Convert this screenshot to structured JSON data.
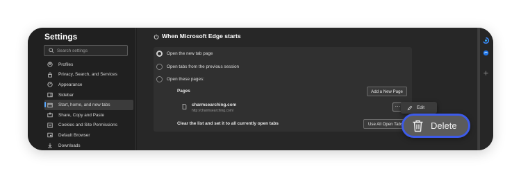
{
  "sidebar": {
    "title": "Settings",
    "search_placeholder": "Search settings",
    "items": [
      {
        "label": "Profiles",
        "icon": "profile-icon"
      },
      {
        "label": "Privacy, Search, and Services",
        "icon": "lock-icon"
      },
      {
        "label": "Appearance",
        "icon": "appearance-icon"
      },
      {
        "label": "Sidebar",
        "icon": "sidebar-icon"
      },
      {
        "label": "Start, home, and new tabs",
        "icon": "home-icon",
        "active": true
      },
      {
        "label": "Share, Copy and Paste",
        "icon": "share-icon"
      },
      {
        "label": "Cookies and Site Permissions",
        "icon": "cookies-icon"
      },
      {
        "label": "Default Browser",
        "icon": "browser-icon"
      },
      {
        "label": "Downloads",
        "icon": "download-icon"
      }
    ]
  },
  "main": {
    "section_title": "When Microsoft Edge starts",
    "options": [
      {
        "label": "Open the new tab page",
        "checked": true
      },
      {
        "label": "Open tabs from the previous session",
        "checked": false
      },
      {
        "label": "Open these pages:",
        "checked": false
      }
    ],
    "pages_label": "Pages",
    "add_page_button": "Add a New Page",
    "page": {
      "name": "charmsearching.com",
      "url": "http://charmsearching.com/"
    },
    "more_button": "···",
    "clear_label": "Clear the list and set it to all currently open tabs",
    "use_open_tabs_button": "Use All Open Tabs"
  },
  "context_menu": {
    "edit_label": "Edit",
    "delete_label": "Delete"
  },
  "colors": {
    "accent": "#3d5bea",
    "active_indicator": "#5aa9ff",
    "background": "#1f1f1f"
  }
}
